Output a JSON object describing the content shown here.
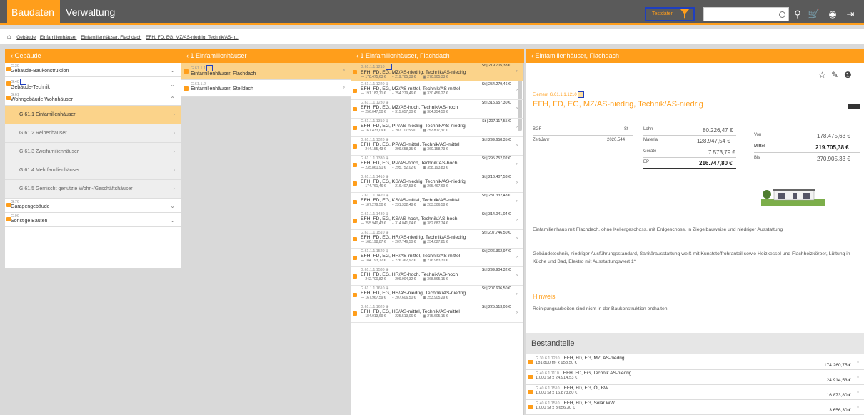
{
  "topbar": {
    "tab_active": "Baudaten",
    "tab_inactive": "Verwaltung",
    "filter_label": "Testdaten",
    "search_placeholder": ""
  },
  "breadcrumb": [
    "Gebäude",
    "Einfamilienhäuser",
    "Einfamilienhäuser, Flachdach",
    "EFH, FD, EG, MZ/AS-niedrig, Technik/AS-n..."
  ],
  "col1": {
    "header": "Gebäude",
    "items": [
      {
        "code": "G.30",
        "name": "Gebäude-Baukonstruktion",
        "chev": "⌄"
      },
      {
        "code": "G.40",
        "name": "Gebäude-Technik",
        "chev": "⌄"
      },
      {
        "code": "G.61",
        "name": "Wohngebäude Wohnhäuser",
        "chev": "⌃"
      }
    ],
    "subs": [
      "G.61.1 Einfamilienhäuser",
      "G.61.2 Reihenhäuser",
      "G.61.3 Zweifamilienhäuser",
      "G.61.4 Mehrfamilienhäuser",
      "G.61.5 Gemischt genutzte Wohn-/Geschäftshäuser"
    ],
    "items2": [
      {
        "code": "G.76",
        "name": "Garagengebäude"
      },
      {
        "code": "G.99",
        "name": "Sonstige Bauten"
      }
    ]
  },
  "col2": {
    "header": "1 Einfamilienhäuser",
    "items": [
      {
        "code": "G.61.1.1",
        "name": "Einfamilienhäuser, Flachdach"
      },
      {
        "code": "G.61.1.2",
        "name": "Einfamilienhäuser, Steildach"
      }
    ]
  },
  "col3": {
    "header": "1 Einfamilienhäuser, Flachdach",
    "rows": [
      {
        "code": "G.61.1.1.1210",
        "price": "St | 219.705,38 €",
        "name": "EFH, FD, EG, MZ/AS-niedrig, Technik/AS-niedrig",
        "d1": "178.475,63 €",
        "d2": "219.705,38 €",
        "d3": "270.905,33 €"
      },
      {
        "code": "G.61.1.1.1220",
        "price": "St | 254.279,46 €",
        "name": "EFH, FD, EG, MZ/AS-mittel, Technik/AS-mittel",
        "d1": "191.182,71 €",
        "d2": "254.279,46 €",
        "d3": "330.456,27 €"
      },
      {
        "code": "G.61.1.1.1230",
        "price": "St | 315.657,30 €",
        "name": "EFH, FD, EG, MZ/AS-hoch, Technik/AS-hoch",
        "d1": "256.047,50 €",
        "d2": "315.657,30 €",
        "d3": "384.254,50 €"
      },
      {
        "code": "G.61.1.1.1310",
        "price": "St | 207.117,55 €",
        "name": "EFH, FD, EG, PP/AS-niedrig, Technik/AS-niedrig",
        "d1": "167.433,09 €",
        "d2": "207.117,55 €",
        "d3": "252.807,37 €"
      },
      {
        "code": "G.61.1.1.1320",
        "price": "St | 299.658,35 €",
        "name": "EFH, FD, EG, PP/AS-mittel, Technik/AS-mittel",
        "d1": "244.155,43 €",
        "d2": "299.658,35 €",
        "d3": "360.158,73 €"
      },
      {
        "code": "G.61.1.1.1330",
        "price": "St | 295.752,02 €",
        "name": "EFH, FD, EG, PP/AS-hoch, Technik/AS-hoch",
        "d1": "235.861,91 €",
        "d2": "295.752,02 €",
        "d3": "358.193,83 €"
      },
      {
        "code": "G.61.1.1.1410",
        "price": "St | 216.407,53 €",
        "name": "EFH, FD, EG, KS/AS-niedrig, Technik/AS-niedrig",
        "d1": "174.761,46 €",
        "d2": "216.407,53 €",
        "d3": "265.467,69 €"
      },
      {
        "code": "G.61.1.1.1420",
        "price": "St | 231.332,48 €",
        "name": "EFH, FD, EG, KS/AS-mittel, Technik/AS-mittel",
        "d1": "187.279,50 €",
        "d2": "231.332,48 €",
        "d3": "283.306,58 €"
      },
      {
        "code": "G.61.1.1.1430",
        "price": "St | 314.041,04 €",
        "name": "EFH, FD, EG, KS/AS-hoch, Technik/AS-hoch",
        "d1": "255.940,43 €",
        "d2": "314.041,04 €",
        "d3": "382.687,74 €"
      },
      {
        "code": "G.61.1.1.1510",
        "price": "St | 207.746,50 €",
        "name": "EFH, FD, EG, HR/AS-niedrig, Technik/AS-niedrig",
        "d1": "168.198,87 €",
        "d2": "207.746,50 €",
        "d3": "254.027,81 €"
      },
      {
        "code": "G.61.1.1.1520",
        "price": "St | 226.362,97 €",
        "name": "EFH, FD, EG, HR/AS-mittel, Technik/AS-mittel",
        "d1": "184.193,72 €",
        "d2": "226.362,97 €",
        "d3": "276.983,30 €"
      },
      {
        "code": "G.61.1.1.1530",
        "price": "St | 299.904,32 €",
        "name": "EFH, FD, EG, HR/AS-hoch, Technik/AS-hoch",
        "d1": "242.700,82 €",
        "d2": "299.904,32 €",
        "d3": "368.565,15 €"
      },
      {
        "code": "G.61.1.1.1610",
        "price": "St | 207.606,50 €",
        "name": "EFH, FD, EG, HS/AS-niedrig, Technik/AS-niedrig",
        "d1": "167.967,59 €",
        "d2": "207.606,50 €",
        "d3": "253.905,29 €"
      },
      {
        "code": "G.61.1.1.1620",
        "price": "St | 225.513,06 €",
        "name": "EFH, FD, EG, HS/AS-mittel, Technik/AS-mittel",
        "d1": "184.013,69 €",
        "d2": "225.513,06 €",
        "d3": "275.605,15 €"
      }
    ]
  },
  "col4": {
    "header": "Einfamilienhäuser, Flachdach",
    "catlabel": "Element G.61.1.1.1210",
    "title": "EFH, FD, EG, MZ/AS-niedrig, Technik/AS-niedrig",
    "kv": {
      "bgf_lbl": "BGF",
      "bgf_val": "St",
      "jahr_lbl": "Zeit/Jahr",
      "jahr_val": "2020.544",
      "lohn_lbl": "Lohn",
      "lohn_val": "80.226,47 €",
      "mat_lbl": "Material",
      "mat_val": "128.947,54 €",
      "ger_lbl": "Geräte",
      "ger_val": "7.573,79 €",
      "ep_lbl": "EP",
      "ep_val": "216.747,80 €",
      "von_lbl": "Von",
      "von_val": "178.475,63 €",
      "mit_lbl": "Mittel",
      "mit_val": "219.705,38 €",
      "bis_lbl": "Bis",
      "bis_val": "270.905,33 €"
    },
    "desc1": "Einfamilienhaus mit Flachdach, ohne Kellergeschoss, mit Erdgeschoss, in Ziegelbauweise und niedriger Ausstattung",
    "desc2": "Gebäudetechnik, niedriger Ausführungsstandard, Sanitärausstattung weiß mit Kunststoffrohranteil sowie Heizkessel und Flachheizkörper, Lüftung in Küche und Bad, Elektro mit Ausstattungswert 1*",
    "hinweis": "Hinweis",
    "hinweis_text": "Reinigungsarbeiten sind nicht in der Baukonstruktion enthalten.",
    "bestandteile": "Bestandteile",
    "parts": [
      {
        "code": "G.30.6.1.1210",
        "name": "EFH, FD, EG, MZ, AS-niedrig",
        "qty": "181,800 m² x 958,50 €",
        "price": "174.260,75 €"
      },
      {
        "code": "G.40.6.1.1110",
        "name": "EFH, FD, EG, Technik AS-niedrig",
        "qty": "1,000 St x 24.914,53 €",
        "price": "24.914,53 €"
      },
      {
        "code": "G.40.6.1.1510",
        "name": "EFH, FD, EG, Öl, BW",
        "qty": "1,000 St x 16.873,80 €",
        "price": "16.873,80 €"
      },
      {
        "code": "G.40.6.1.1510",
        "name": "EFH, FD, EG, Solar WW",
        "qty": "1,000 St x 3.656,30 €",
        "price": "3.656,30 €"
      }
    ]
  },
  "colors": {
    "accent": "#ff9e1b",
    "topbar": "#5a5a5a",
    "highlight": "#1f3fbf"
  }
}
